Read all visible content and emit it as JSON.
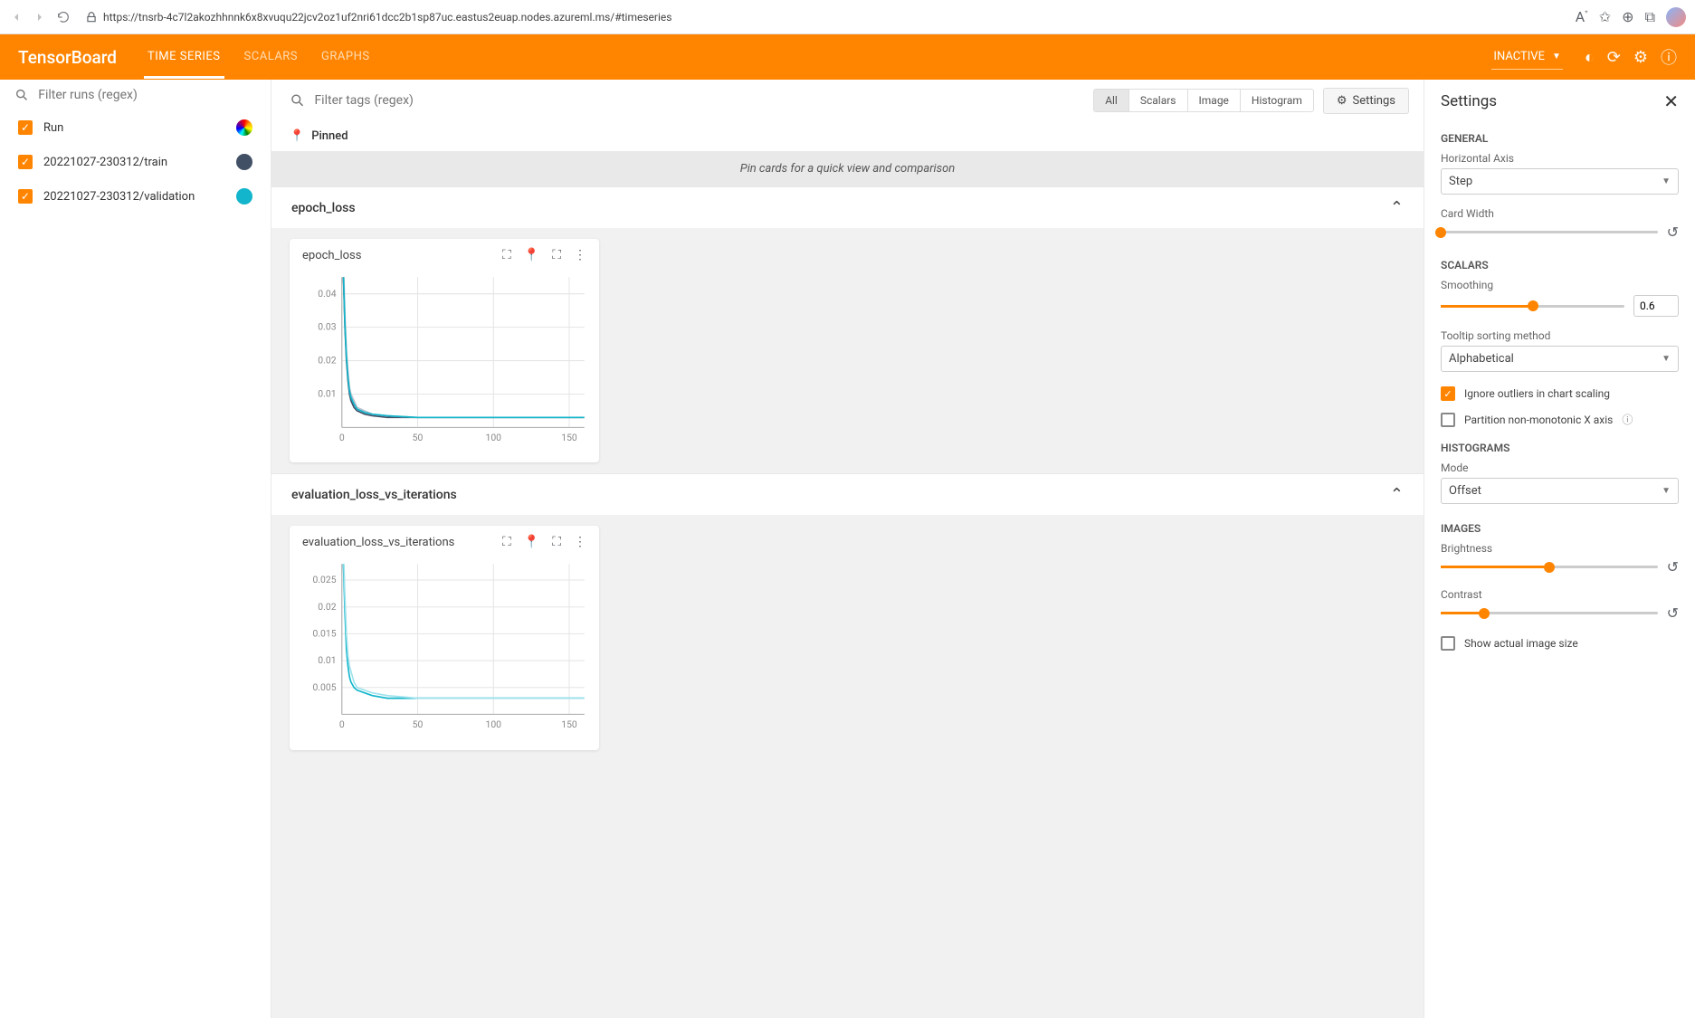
{
  "browser": {
    "url": "https://tnsrb-4c7l2akozhhnnk6x8xvuqu22jcv2oz1uf2nri61dcc2b1sp87uc.eastus2euap.nodes.azureml.ms/#timeseries"
  },
  "header": {
    "title": "TensorBoard",
    "tabs": [
      "TIME SERIES",
      "SCALARS",
      "GRAPHS"
    ],
    "active_tab": 0,
    "status": "INACTIVE"
  },
  "left": {
    "filter_placeholder": "Filter runs (regex)",
    "runs": [
      {
        "name": "Run",
        "color": "#000000"
      },
      {
        "name": "20221027-230312/train",
        "color": "#425066"
      },
      {
        "name": "20221027-230312/validation",
        "color": "#12b5cb"
      }
    ]
  },
  "main": {
    "filter_placeholder": "Filter tags (regex)",
    "view_options": [
      "All",
      "Scalars",
      "Image",
      "Histogram"
    ],
    "active_view": 0,
    "settings_btn": "Settings",
    "pinned_label": "Pinned",
    "pin_hint": "Pin cards for a quick view and comparison",
    "sections": [
      {
        "title": "epoch_loss",
        "cards": [
          {
            "title": "epoch_loss"
          }
        ]
      },
      {
        "title": "evaluation_loss_vs_iterations",
        "cards": [
          {
            "title": "evaluation_loss_vs_iterations"
          }
        ]
      }
    ]
  },
  "settings": {
    "title": "Settings",
    "general": {
      "heading": "GENERAL",
      "horizontal_axis_label": "Horizontal Axis",
      "horizontal_axis_value": "Step",
      "card_width_label": "Card Width"
    },
    "scalars": {
      "heading": "SCALARS",
      "smoothing_label": "Smoothing",
      "smoothing_value": "0.6",
      "tooltip_label": "Tooltip sorting method",
      "tooltip_value": "Alphabetical",
      "ignore_outliers": "Ignore outliers in chart scaling",
      "partition_x": "Partition non-monotonic X axis"
    },
    "histograms": {
      "heading": "HISTOGRAMS",
      "mode_label": "Mode",
      "mode_value": "Offset"
    },
    "images": {
      "heading": "IMAGES",
      "brightness_label": "Brightness",
      "contrast_label": "Contrast",
      "show_actual": "Show actual image size"
    }
  },
  "chart_data": [
    {
      "type": "line",
      "title": "epoch_loss",
      "xlabel": "",
      "ylabel": "",
      "xlim": [
        0,
        160
      ],
      "ylim": [
        0,
        0.045
      ],
      "xticks": [
        0,
        50,
        100,
        150
      ],
      "yticks": [
        0.01,
        0.02,
        0.03,
        0.04
      ],
      "series": [
        {
          "name": "20221027-230312/train",
          "color": "#425066",
          "x": [
            0,
            1,
            2,
            3,
            4,
            5,
            6,
            8,
            10,
            15,
            20,
            30,
            50,
            80,
            120,
            160
          ],
          "values": [
            0.08,
            0.045,
            0.03,
            0.02,
            0.014,
            0.01,
            0.008,
            0.006,
            0.005,
            0.004,
            0.0035,
            0.003,
            0.003,
            0.003,
            0.003,
            0.003
          ]
        },
        {
          "name": "20221027-230312/train (smoothed)",
          "color": "#b7c0ce",
          "x": [
            0,
            1,
            2,
            3,
            4,
            5,
            6,
            8,
            10,
            15,
            20,
            30,
            50,
            80,
            120,
            160
          ],
          "values": [
            0.08,
            0.05,
            0.034,
            0.023,
            0.017,
            0.012,
            0.01,
            0.008,
            0.006,
            0.005,
            0.004,
            0.0035,
            0.003,
            0.003,
            0.003,
            0.003
          ]
        },
        {
          "name": "20221027-230312/validation",
          "color": "#12b5cb",
          "x": [
            0,
            1,
            2,
            3,
            4,
            5,
            6,
            8,
            10,
            15,
            20,
            30,
            50,
            80,
            120,
            160
          ],
          "values": [
            0.08,
            0.046,
            0.031,
            0.021,
            0.015,
            0.011,
            0.009,
            0.007,
            0.0055,
            0.0045,
            0.004,
            0.0035,
            0.003,
            0.003,
            0.003,
            0.003
          ]
        }
      ]
    },
    {
      "type": "line",
      "title": "evaluation_loss_vs_iterations",
      "xlabel": "",
      "ylabel": "",
      "xlim": [
        0,
        160
      ],
      "ylim": [
        0,
        0.028
      ],
      "xticks": [
        0,
        50,
        100,
        150
      ],
      "yticks": [
        0.005,
        0.01,
        0.015,
        0.02,
        0.025
      ],
      "series": [
        {
          "name": "20221027-230312/validation",
          "color": "#12b5cb",
          "x": [
            0,
            1,
            2,
            3,
            4,
            5,
            6,
            8,
            10,
            15,
            20,
            30,
            50,
            80,
            120,
            160
          ],
          "values": [
            0.05,
            0.028,
            0.019,
            0.012,
            0.009,
            0.007,
            0.006,
            0.005,
            0.0045,
            0.004,
            0.0035,
            0.003,
            0.003,
            0.003,
            0.003,
            0.003
          ]
        },
        {
          "name": "20221027-230312/validation (smoothed)",
          "color": "#9fe2ec",
          "x": [
            0,
            1,
            2,
            3,
            4,
            5,
            6,
            8,
            10,
            15,
            20,
            30,
            50,
            80,
            120,
            160
          ],
          "values": [
            0.05,
            0.031,
            0.022,
            0.015,
            0.011,
            0.009,
            0.008,
            0.006,
            0.005,
            0.0045,
            0.004,
            0.0035,
            0.003,
            0.003,
            0.003,
            0.003
          ]
        }
      ]
    }
  ]
}
